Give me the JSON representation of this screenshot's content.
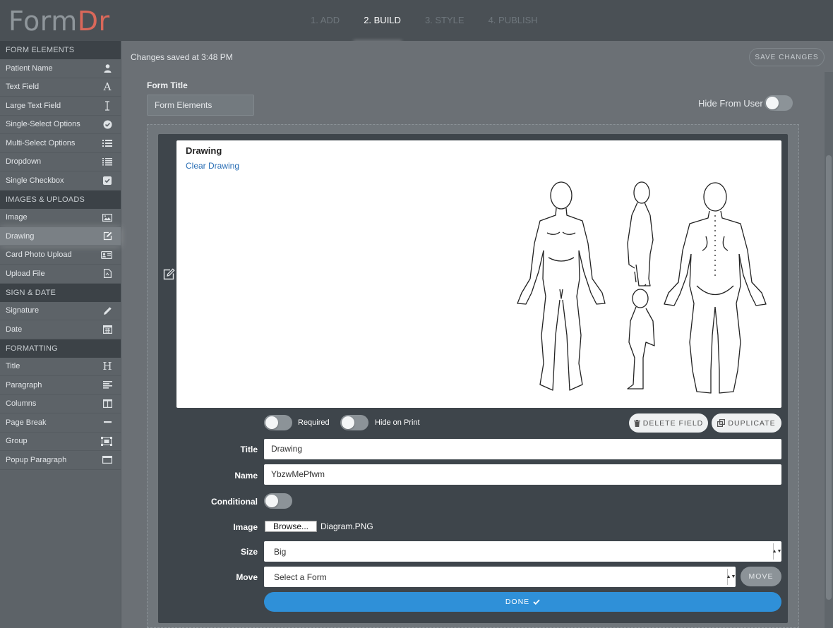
{
  "app": {
    "logo_part1": "Form",
    "logo_part2": "Dr",
    "steps": [
      "1. ADD",
      "2. BUILD",
      "3. STYLE",
      "4. PUBLISH"
    ],
    "active_step": 1
  },
  "sidebar": {
    "sections": [
      {
        "title": "FORM ELEMENTS",
        "items": [
          {
            "label": "Patient Name",
            "icon": "user-icon"
          },
          {
            "label": "Text Field",
            "icon": "font-icon"
          },
          {
            "label": "Large Text Field",
            "icon": "text-cursor-icon"
          },
          {
            "label": "Single-Select Options",
            "icon": "check-circle-icon"
          },
          {
            "label": "Multi-Select Options",
            "icon": "list-icon"
          },
          {
            "label": "Dropdown",
            "icon": "list-alt-icon"
          },
          {
            "label": "Single Checkbox",
            "icon": "check-square-icon"
          }
        ]
      },
      {
        "title": "IMAGES & UPLOADS",
        "items": [
          {
            "label": "Image",
            "icon": "picture-icon"
          },
          {
            "label": "Drawing",
            "icon": "edit-icon",
            "active": true
          },
          {
            "label": "Card Photo Upload",
            "icon": "id-card-icon"
          },
          {
            "label": "Upload File",
            "icon": "file-icon"
          }
        ]
      },
      {
        "title": "SIGN & DATE",
        "items": [
          {
            "label": "Signature",
            "icon": "pencil-icon"
          },
          {
            "label": "Date",
            "icon": "calendar-icon"
          }
        ]
      },
      {
        "title": "FORMATTING",
        "items": [
          {
            "label": "Title",
            "icon": "heading-icon"
          },
          {
            "label": "Paragraph",
            "icon": "align-left-icon"
          },
          {
            "label": "Columns",
            "icon": "columns-icon"
          },
          {
            "label": "Page Break",
            "icon": "minus-icon"
          },
          {
            "label": "Group",
            "icon": "group-icon"
          },
          {
            "label": "Popup Paragraph",
            "icon": "window-icon"
          }
        ]
      }
    ]
  },
  "header": {
    "status": "Changes saved at 3:48 PM",
    "save_label": "SAVE CHANGES"
  },
  "form": {
    "title_label": "Form Title",
    "title_value": "Form Elements",
    "hide_label": "Hide From User",
    "hide_on": false
  },
  "field": {
    "drawing_title": "Drawing",
    "clear_label": "Clear Drawing",
    "required_label": "Required",
    "hide_print_label": "Hide on Print",
    "delete_label": "DELETE FIELD",
    "duplicate_label": "DUPLICATE",
    "title_label": "Title",
    "title_value": "Drawing",
    "name_label": "Name",
    "name_value": "YbzwMePfwm",
    "conditional_label": "Conditional",
    "image_label": "Image",
    "browse_label": "Browse...",
    "image_file": "Diagram.PNG",
    "size_label": "Size",
    "size_value": "Big",
    "move_label": "Move",
    "move_value": "Select a Form",
    "move_button": "MOVE",
    "done_label": "DONE"
  },
  "colors": {
    "accent": "#2f90d8",
    "logo_accent": "#d9685a",
    "link": "#2b6fb5"
  }
}
